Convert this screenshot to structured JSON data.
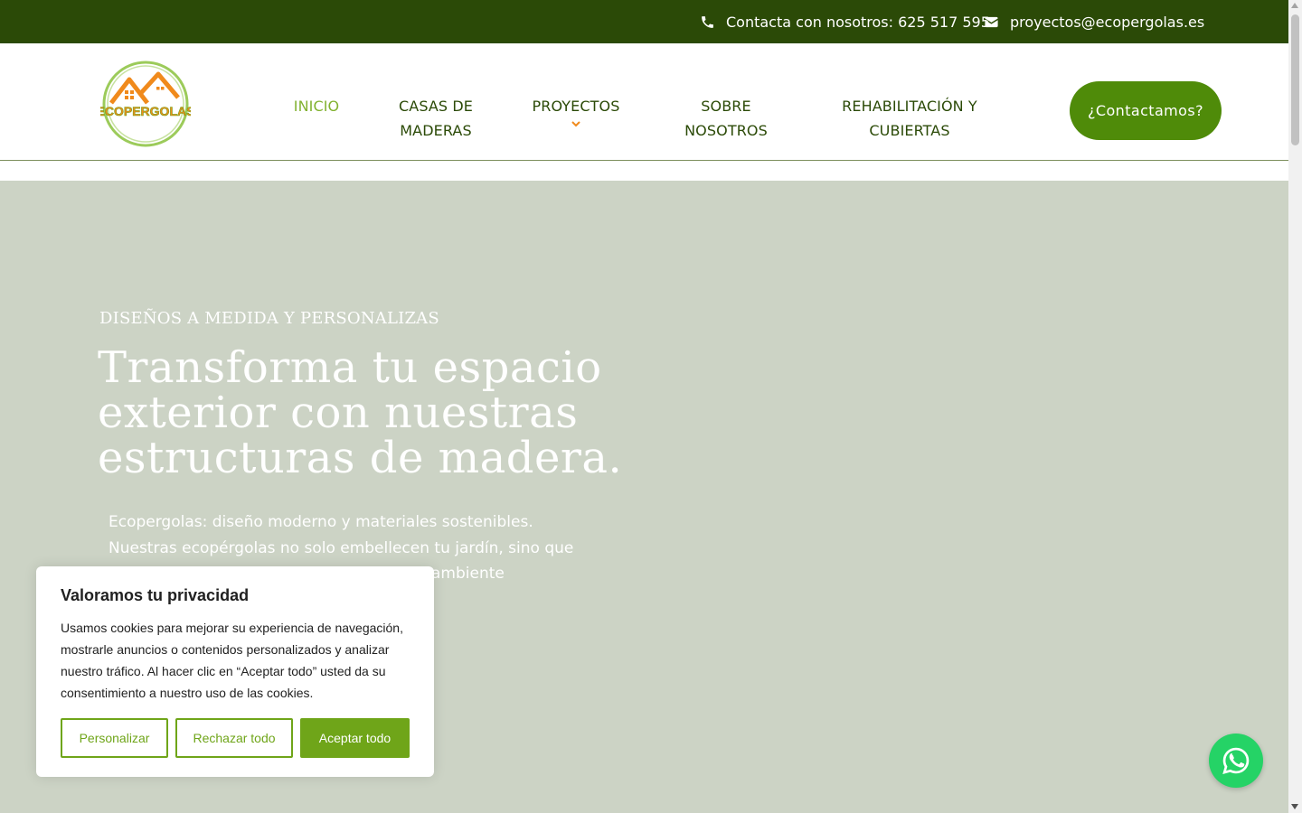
{
  "topbar": {
    "phone_text": "Contacta con nosotros: 625 517 595",
    "email_text": "proyectos@ecopergolas.es",
    "phone_icon": "phone-icon",
    "email_icon": "envelope-icon"
  },
  "logo": {
    "text": "ECOPERGOLAS"
  },
  "nav": {
    "inicio": "INICIO",
    "casas_1": "CASAS DE",
    "casas_2": "MADERAS",
    "proyectos": "PROYECTOS",
    "sobre_1": "SOBRE",
    "sobre_2": "NOSOTROS",
    "rehab_1": "REHABILITACIÓN Y",
    "rehab_2": "CUBIERTAS",
    "cta": "¿Contactamos?"
  },
  "hero": {
    "eyebrow": "DISEÑOS A MEDIDA Y PERSONALIZAS",
    "title_1": "Transforma tu espacio",
    "title_2": "exterior con nuestras",
    "title_3": "estructuras de madera.",
    "desc_1": "Ecopergolas: diseño moderno y materiales sostenibles.",
    "desc_2": "Nuestras ecopérgolas no solo embellecen tu jardín, sino que",
    "desc_3": "ambiente"
  },
  "cookie": {
    "title": "Valoramos tu privacidad",
    "text": "Usamos cookies para mejorar su experiencia de navegación, mostrarle anuncios o contenidos personalizados y analizar nuestro tráfico. Al hacer clic en “Aceptar todo” usted da su consentimiento a nuestro uso de las cookies.",
    "customize": "Personalizar",
    "reject": "Rechazar todo",
    "accept": "Aceptar todo"
  },
  "colors": {
    "topbar_bg": "#2b4a07",
    "nav_text": "#2b4a07",
    "nav_active": "#82b231",
    "cta_bg": "#4f8b09",
    "hero_bg": "#ccd3c5",
    "cookie_accent": "#6fa519",
    "whatsapp": "#25d366"
  }
}
